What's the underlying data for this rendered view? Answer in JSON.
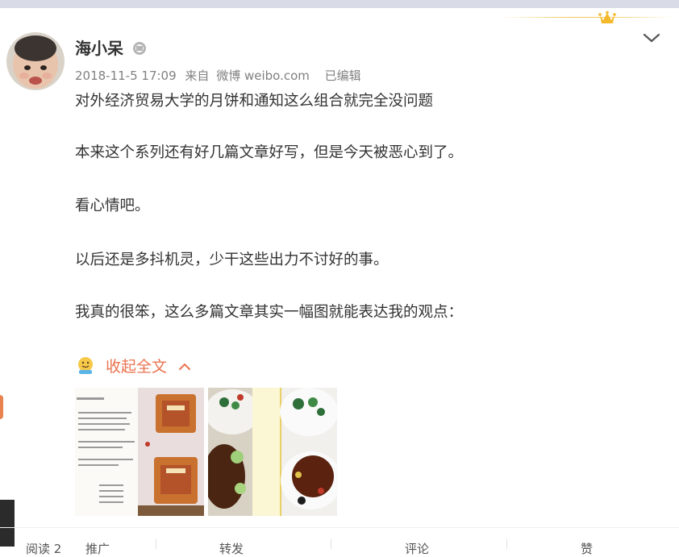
{
  "post": {
    "username": "海小呆",
    "timestamp": "2018-11-5 17:09",
    "source_prefix": "来自",
    "source": "微博 weibo.com",
    "edited": "已编辑",
    "paragraphs": [
      "对外经济贸易大学的月饼和通知这么组合就完全没问题",
      "本来这个系列还有好几篇文章好写，但是今天被恶心到了。",
      "看心情吧。",
      "以后还是多抖机灵，少干这些出力不讨好的事。",
      "我真的很笨，这么多篇文章其实一幅图就能表达我的观点："
    ],
    "collapse_label": "收起全文"
  },
  "bottom_bar": {
    "items": [
      "阅读 2",
      "推广",
      "转发",
      "评论",
      "赞"
    ]
  },
  "colors": {
    "accent": "#eb7350",
    "gold": "#f0c85a",
    "meta_gray": "#808080"
  },
  "icons": [
    "crown-icon",
    "chevron-down-icon",
    "verified-icon",
    "emoji-icon",
    "chevron-up-icon"
  ]
}
